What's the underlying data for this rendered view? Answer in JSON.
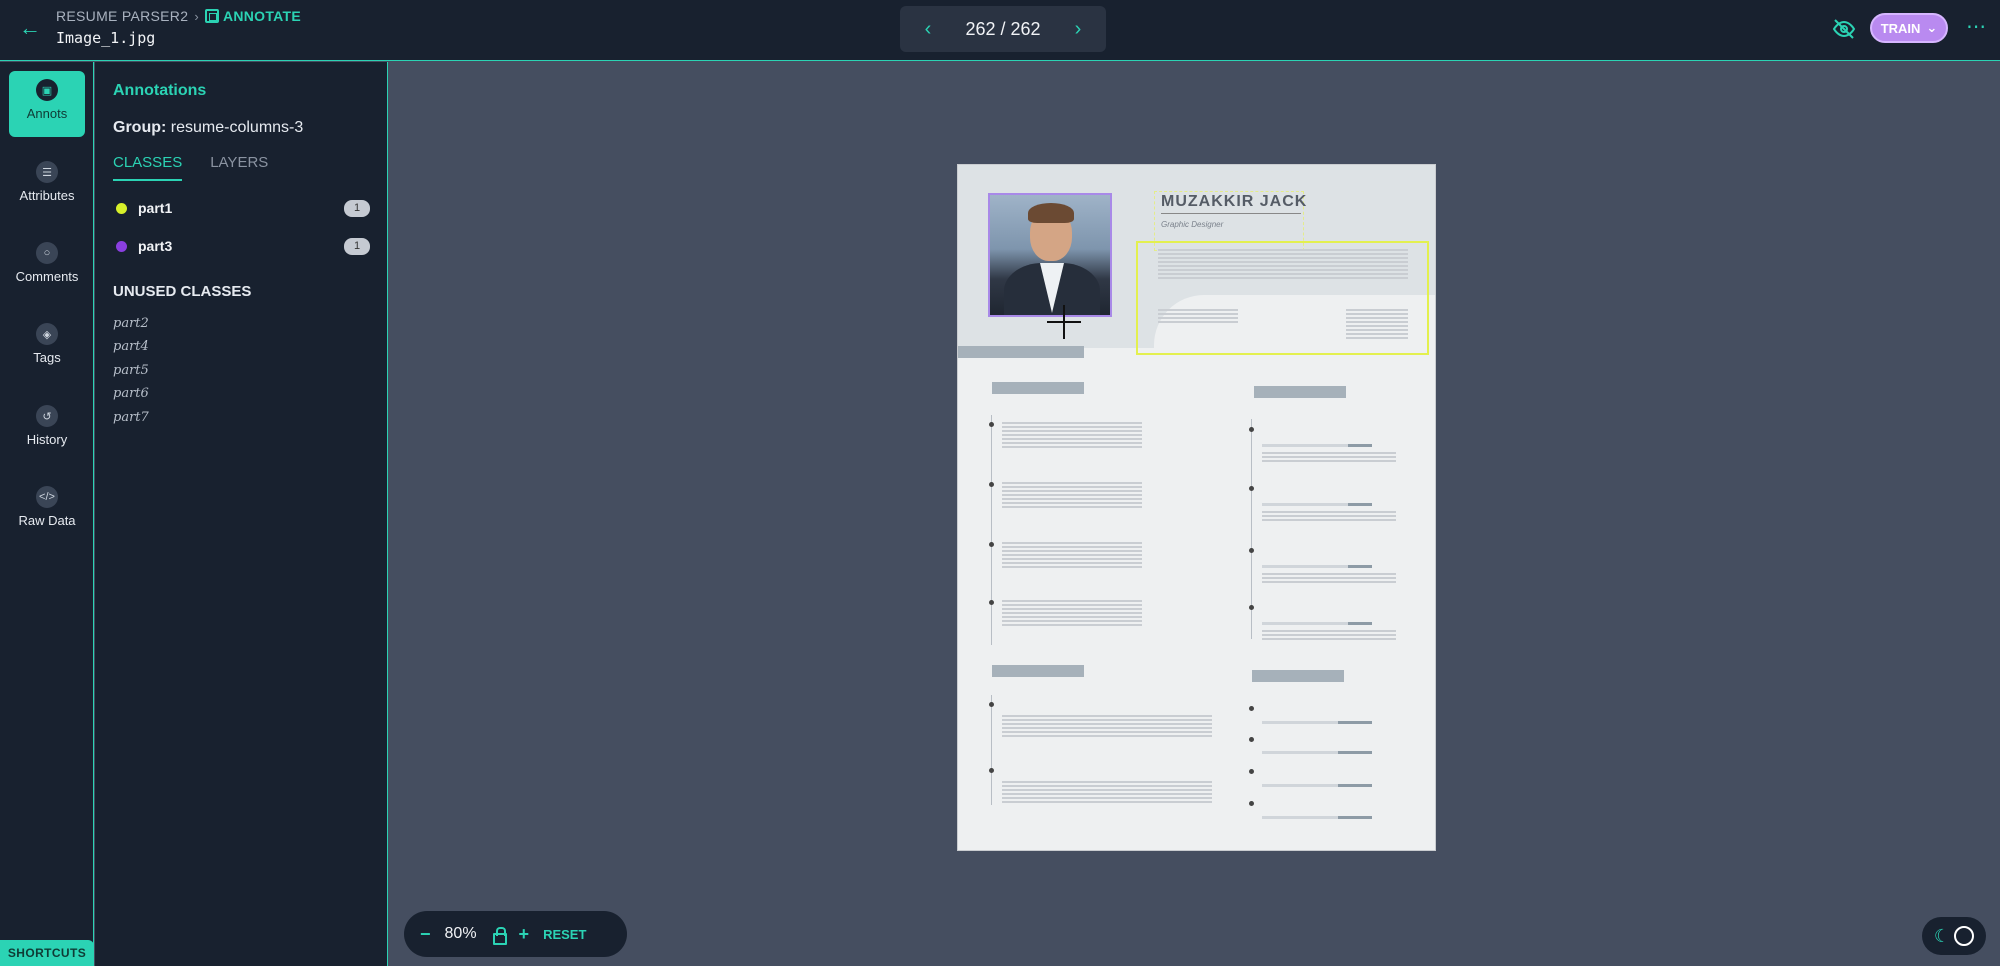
{
  "header": {
    "breadcrumb_root": "RESUME PARSER2",
    "breadcrumb_current": "ANNOTATE",
    "filename": "Image_1.jpg",
    "pager": "262 / 262",
    "train_label": "TRAIN"
  },
  "rail": {
    "items": [
      {
        "label": "Annots",
        "icon": "annotation-icon"
      },
      {
        "label": "Attributes",
        "icon": "list-icon"
      },
      {
        "label": "Comments",
        "icon": "comment-icon"
      },
      {
        "label": "Tags",
        "icon": "tag-icon"
      },
      {
        "label": "History",
        "icon": "history-icon"
      },
      {
        "label": "Raw Data",
        "icon": "code-icon"
      }
    ],
    "shortcuts_label": "SHORTCUTS"
  },
  "panel": {
    "title": "Annotations",
    "group_label": "Group:",
    "group_value": "resume-columns-3",
    "tabs": [
      "CLASSES",
      "LAYERS"
    ],
    "classes": [
      {
        "name": "part1",
        "count": "1",
        "color": "#d7f02a"
      },
      {
        "name": "part3",
        "count": "1",
        "color": "#8a3fe0"
      }
    ],
    "unused_title": "UNUSED CLASSES",
    "unused": [
      "part2",
      "part4",
      "part5",
      "part6",
      "part7"
    ]
  },
  "document": {
    "name": "MUZAKKIR JACK",
    "role": "Graphic Designer"
  },
  "zoom": {
    "value": "80%",
    "reset_label": "RESET"
  }
}
